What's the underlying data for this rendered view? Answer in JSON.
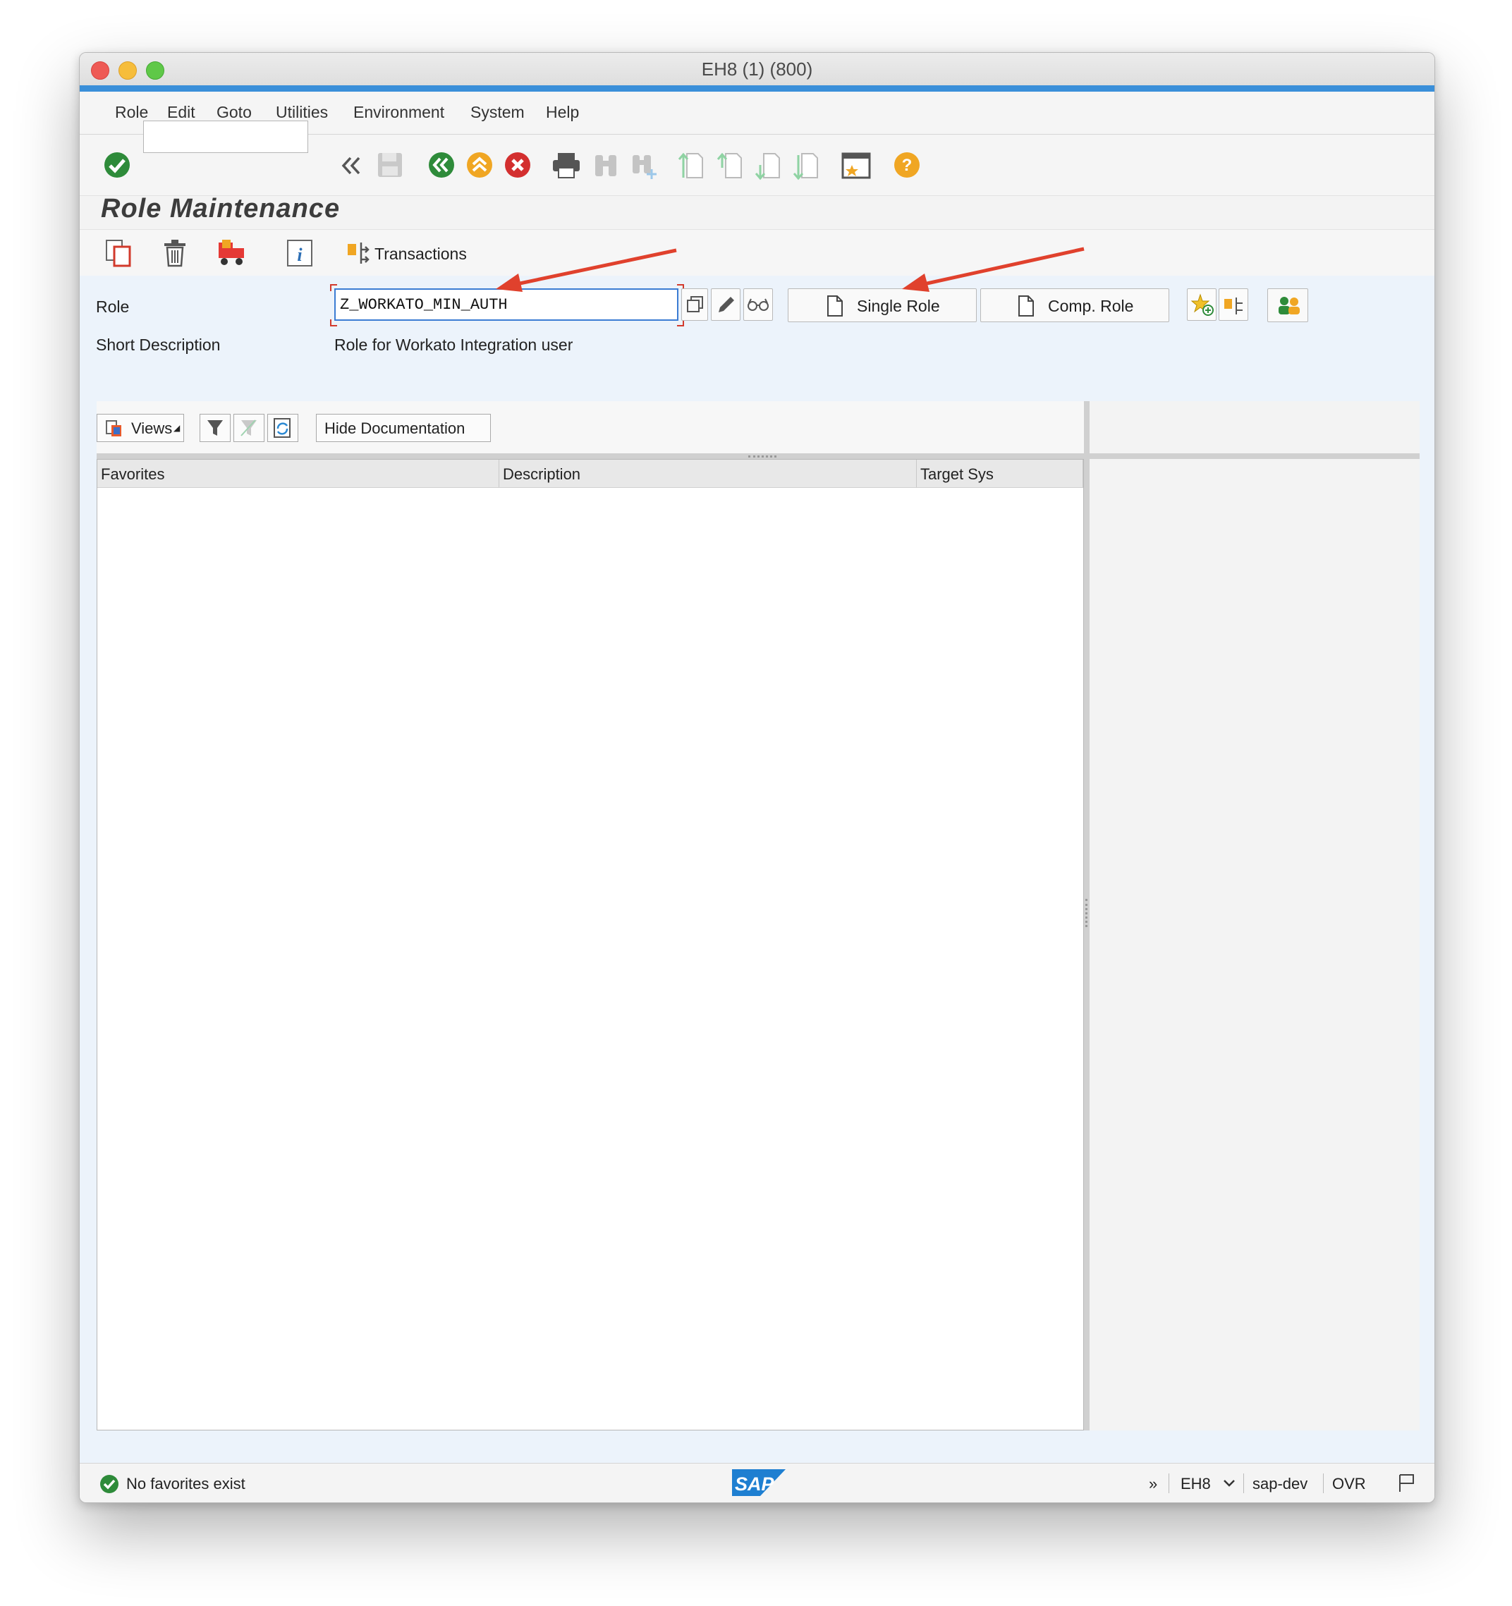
{
  "window": {
    "title": "EH8 (1) (800)"
  },
  "menu": [
    "Role",
    "Edit",
    "Goto",
    "Utilities",
    "Environment",
    "System",
    "Help"
  ],
  "toolbar": {
    "command_field_value": "",
    "icons": [
      "enter-icon",
      "back-double-chevron-icon",
      "save-icon",
      "back-icon",
      "exit-icon",
      "cancel-icon",
      "print-icon",
      "find-icon",
      "find-next-icon",
      "first-page-icon",
      "previous-page-icon",
      "next-page-icon",
      "last-page-icon",
      "create-session-icon",
      "help-icon"
    ]
  },
  "page_title": "Role Maintenance",
  "app_toolbar": {
    "icons": [
      "copy-role-icon",
      "delete-role-icon",
      "transport-icon",
      "information-icon"
    ],
    "transactions_label": "Transactions"
  },
  "form": {
    "role_label": "Role",
    "role_value": "Z_WORKATO_MIN_AUTH",
    "short_description_label": "Short Description",
    "short_description_value": "Role for Workato Integration user",
    "single_role_label": "Single Role",
    "comp_role_label": "Comp. Role"
  },
  "panel": {
    "views_label": "Views",
    "hide_documentation_label": "Hide Documentation",
    "columns": [
      "Favorites",
      "Description",
      "Target Sys"
    ]
  },
  "status": {
    "message": "No favorites exist",
    "system": "EH8",
    "server": "sap-dev",
    "mode": "OVR"
  },
  "colors": {
    "accent_blue": "#3a8fd9",
    "form_background": "#ecf3fb",
    "annotation_arrow": "#e0412d",
    "success_green": "#2e8b3a"
  }
}
